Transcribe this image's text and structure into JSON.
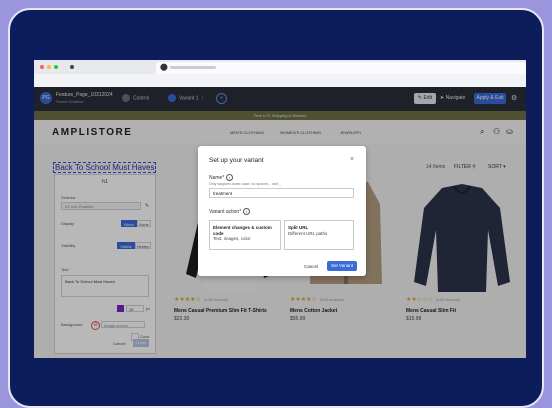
{
  "colors": {
    "background": "#9b95dd",
    "frame": "#0d1d5c",
    "accent": "#3a6bd8",
    "toolbar": "#2b2f3a",
    "promo_bar": "#6e7046"
  },
  "browser": {
    "dots": [
      "#ff5f57",
      "#febc2e",
      "#28c840"
    ],
    "tab_icon": "logo-icon"
  },
  "toolbar": {
    "avatar": "PG",
    "project_name": "Feature_Page_10312024",
    "project_sub": "Saved Creative",
    "control_label": "Control",
    "variant_label": "Variant 1",
    "variant_menu": "⋮",
    "add_label": "+",
    "edit_label": "✎ Edit",
    "navigate_label": "➤ Navigate",
    "apply_label": "Apply & Exit",
    "gear": "⚙"
  },
  "promo": "Free U.S. Shipping & Returns",
  "store": {
    "logo": "AMPLISTORE",
    "nav": [
      "MEN'S CLOTHING",
      "WOMEN'S CLOTHING",
      "JEWELERY"
    ],
    "icons": {
      "search": "⌕",
      "user": "⚇",
      "bag": "⛀"
    }
  },
  "content": {
    "headline": "Back To School Must Haves",
    "items": "14 Items",
    "filter": "FILTER ⚲",
    "sort": "SORT ▾"
  },
  "panel": {
    "title": "h1",
    "selector_label": "Selector",
    "selector_value": "#1 Use Enabled",
    "pencil": "✎",
    "display_label": "Display",
    "display_block": "Block",
    "display_none": "None",
    "visibility_label": "Visibility",
    "visible": "Visible",
    "hidden": "Hidden",
    "text_label": "Text",
    "text_value": "Back To School Must Haves",
    "size_value": "12",
    "size_unit": "px",
    "background_label": "Background",
    "bg_placeholder": "Image source",
    "color_label": "Color",
    "cancel": "Cancel",
    "done": "Done"
  },
  "products": [
    {
      "stars": "★★★★☆",
      "reviews": "(128 reviews)",
      "title": "Mens Casual Premium Slim Fit T-Shirts",
      "price": "$22.30"
    },
    {
      "stars": "★★★★☆",
      "reviews": "(500 reviews)",
      "title": "Mens Cotton Jacket",
      "price": "$55.99"
    },
    {
      "stars": "★★☆☆☆",
      "reviews": "(430 reviews)",
      "title": "Mens Casual Slim Fit",
      "price": "$15.99"
    }
  ],
  "modal": {
    "title": "Set up your variant",
    "close": "×",
    "name_label": "Name*",
    "name_hint": "Only supports lower-case, no spaces, - and _",
    "name_value": "treatment",
    "action_label": "Variant action*",
    "option1_title": "Element changes & custom code",
    "option1_desc": "Text, images, color",
    "option2_title": "Split URL",
    "option2_desc": "Different URL paths",
    "cancel": "Cancel",
    "save": "Set Variant"
  }
}
